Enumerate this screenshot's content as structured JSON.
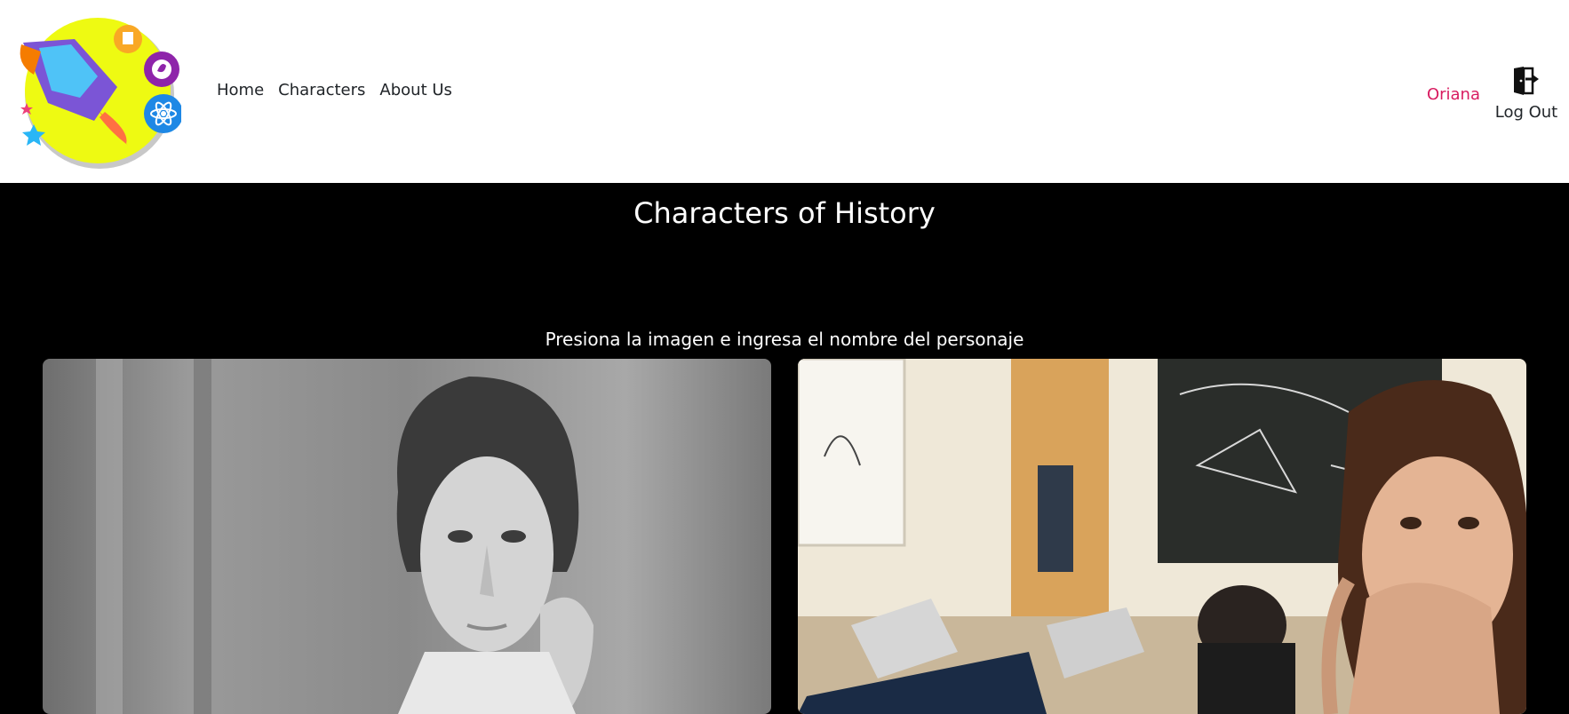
{
  "nav": {
    "links": [
      {
        "label": "Home"
      },
      {
        "label": "Characters"
      },
      {
        "label": "About Us"
      }
    ],
    "user_name": "Oriana",
    "logout_label": "Log Out",
    "icons": {
      "logo": "rocket-logo-icon",
      "logout": "logout-door-icon"
    }
  },
  "main": {
    "title": "Characters of History",
    "instruction": "Presiona la imagen e ingresa el nombre del personaje",
    "cards": [
      {
        "image": "portrait-woman-photo"
      },
      {
        "image": "classroom-selfie-photo"
      }
    ]
  },
  "colors": {
    "background": "#000000",
    "navbar": "#ffffff",
    "user_name": "#d81b60"
  }
}
